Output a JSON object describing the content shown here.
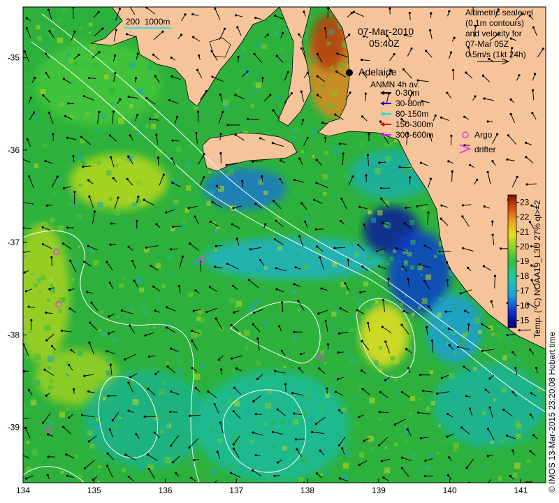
{
  "map": {
    "date_line": "07-Mar-2010",
    "time_line": "05:40Z",
    "scale_bar_label": "200  1000m",
    "city_label": "Adelaide",
    "x_ticks": [
      "134",
      "135",
      "136",
      "137",
      "138",
      "139",
      "140",
      "141"
    ],
    "y_ticks": [
      "-35",
      "-36",
      "-37",
      "-38",
      "-39"
    ],
    "x_range": [
      134.0,
      141.35
    ],
    "y_range": [
      -34.45,
      -39.6
    ],
    "city_position": {
      "lon": 138.6,
      "lat": -34.93
    }
  },
  "info_box": {
    "lines": [
      "Altimetric sealevel",
      "(0.1m contours)",
      "and velocity for",
      "07-Mar 05Z",
      "0.5m/s (1kt 24h)"
    ]
  },
  "legend": {
    "title": "ANMN 4h av.",
    "items": [
      {
        "label": "0-30m",
        "color": "#000000"
      },
      {
        "label": "30-80m",
        "color": "#0000cc"
      },
      {
        "label": "80-150m",
        "color": "#00e5e5"
      },
      {
        "label": "150-300m",
        "color": "#dd0000"
      },
      {
        "label": "300-600m",
        "color": "#ff00ff"
      }
    ],
    "argo_label": "Argo",
    "drifter_label": "drifter",
    "marker_color": "#e040e0"
  },
  "colorbar": {
    "title": "Temp. (°C) NOAA19_L3U 27% ql>=2",
    "ticks": [
      "15",
      "16",
      "17",
      "18",
      "19",
      "20",
      "21",
      "22",
      "23"
    ],
    "range": [
      14.5,
      23.5
    ]
  },
  "footer": {
    "credit": "© IMOS 13-Mar-2015 23:20:08 Hobart time"
  },
  "argo_floats": [
    {
      "lon": 134.47,
      "lat": -37.1
    },
    {
      "lon": 134.5,
      "lat": -37.67
    },
    {
      "lon": 136.51,
      "lat": -37.19
    },
    {
      "lon": 138.19,
      "lat": -38.24
    },
    {
      "lon": 134.36,
      "lat": -39.03
    }
  ],
  "colors": {
    "land": "#f6c49a",
    "ocean_base": "#28b43c",
    "contour": "#ffffff",
    "marker": "#e040e0"
  }
}
